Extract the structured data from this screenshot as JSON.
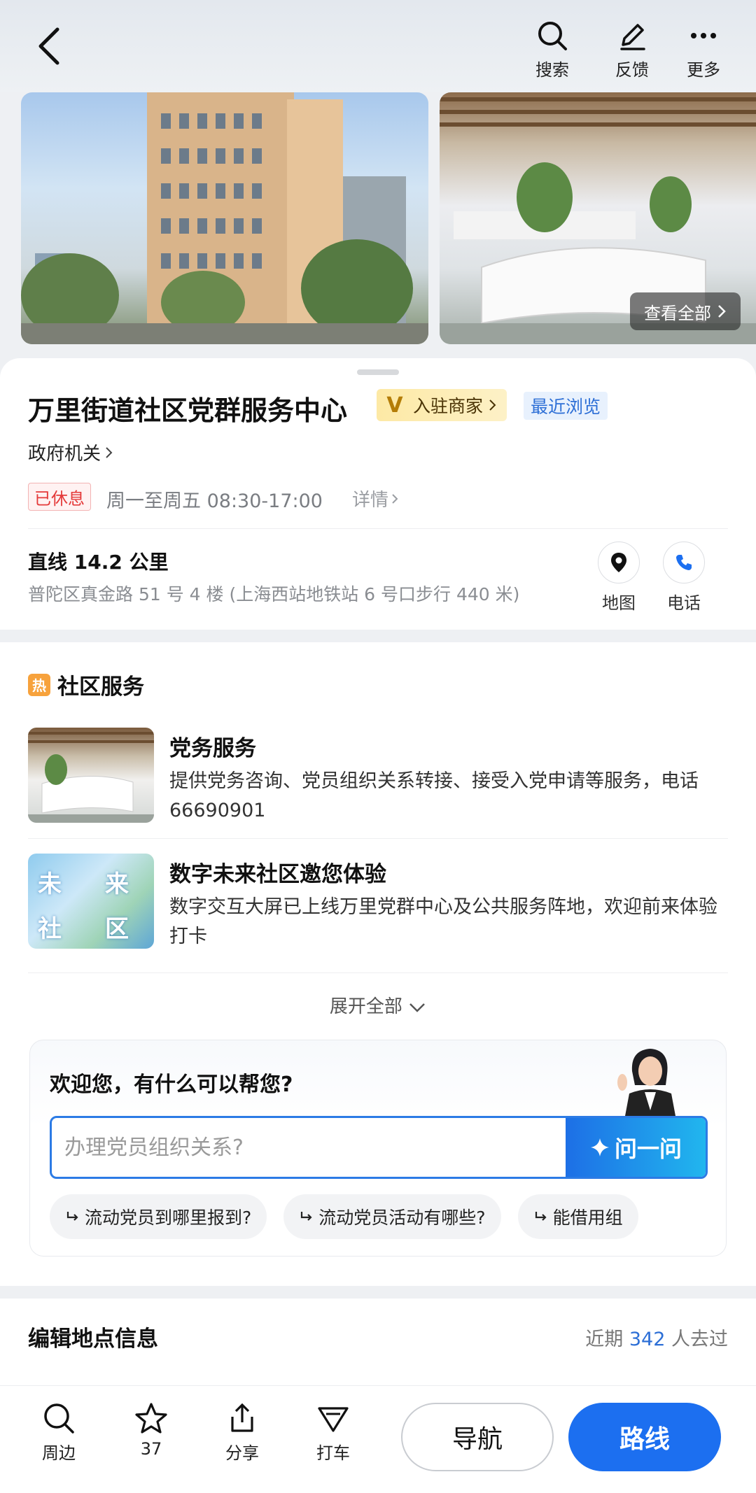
{
  "header": {
    "actions": [
      {
        "label": "搜索",
        "icon": "search-icon"
      },
      {
        "label": "反馈",
        "icon": "feedback-pen-icon"
      },
      {
        "label": "更多",
        "icon": "more-dots-icon"
      }
    ]
  },
  "gallery": {
    "view_all_label": "查看全部"
  },
  "place": {
    "name": "万里街道社区党群服务中心",
    "merchant_badge": "入驻商家",
    "merchant_badge_letter": "V",
    "recent_tag": "最近浏览",
    "category": "政府机关",
    "status": "已休息",
    "hours": "周一至周五 08:30-17:00",
    "hours_detail": "详情",
    "distance": "直线 14.2 公里",
    "address": "普陀区真金路 51 号 4 楼 (上海西站地铁站 6 号口步行 440 米)",
    "map_label": "地图",
    "phone_label": "电话"
  },
  "services": {
    "hot_label": "热",
    "title": "社区服务",
    "items": [
      {
        "name": "党务服务",
        "desc": "提供党务咨询、党员组织关系转接、接受入党申请等服务，电话 66690901"
      },
      {
        "name": "数字未来社区邀您体验",
        "desc": "数字交互大屏已上线万里党群中心及公共服务阵地，欢迎前来体验打卡",
        "thumb_chars": [
          "未",
          "来",
          "社",
          "区"
        ]
      }
    ],
    "expand_label": "展开全部"
  },
  "assistant": {
    "welcome": "欢迎您，有什么可以帮您?",
    "input_placeholder": "办理党员组织关系?",
    "ask_button": "问一问",
    "chips": [
      "流动党员到哪里报到?",
      "流动党员活动有哪些?",
      "能借用组"
    ]
  },
  "edit_info": {
    "title": "编辑地点信息",
    "visited_prefix": "近期",
    "visited_count": "342",
    "visited_suffix": "人去过"
  },
  "bottom_bar": {
    "items": [
      {
        "label": "周边",
        "icon": "search-icon"
      },
      {
        "label": "37",
        "icon": "star-icon"
      },
      {
        "label": "分享",
        "icon": "share-icon"
      },
      {
        "label": "打车",
        "icon": "taxi-icon"
      }
    ],
    "navigate_label": "导航",
    "route_label": "路线"
  },
  "colors": {
    "accent_blue": "#1c6ff0",
    "closed_red": "#e43a3a",
    "hot_orange": "#f7a23c",
    "merchant_gold": "#fde9a5"
  }
}
